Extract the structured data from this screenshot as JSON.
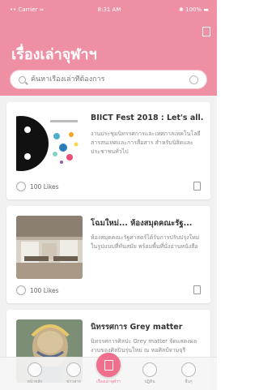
{
  "status_bar": {
    "left": "•• Carrier ≈",
    "time": "8:31 AM",
    "right": "✱ 100% ▬"
  },
  "header": {
    "title": "เรื่องเล่าจุฬาฯ",
    "icon": "document-icon"
  },
  "search": {
    "placeholder": "ค้นหาเรื่องเล่าที่ต้องการ"
  },
  "cards": [
    {
      "title": "BIICT Fest 2018 : Let's all...",
      "description": "งานประชุมนิทรรศการและเทศกาลเทคโนโลยีสารสนเทศและการสื่อสาร สำหรับนิสิตและประชาชนทั่วไป",
      "likes": "100 Likes",
      "icons": [
        "thumb-icon",
        "like-circle-icon",
        "bookmark-icon"
      ]
    },
    {
      "title": "โฉมใหม่... ห้องสมุดคณะรัฐ...",
      "description": "ห้องสมุดคณะรัฐศาสตร์ได้รับการปรับปรุงใหม่ในรูปแบบที่ทันสมัย พร้อมพื้นที่นั่งอ่านหนังสือ",
      "likes": "100 Likes",
      "icons": [
        "thumb-icon",
        "like-circle-icon",
        "bookmark-icon"
      ]
    },
    {
      "title": "นิทรรศการ Grey matter",
      "description": "นิทรรศการศิลปะ Grey matter จัดแสดงผลงานของศิลปินรุ่นใหม่ ณ หอศิลป์จามจุรี",
      "likes": "",
      "icons": [
        "thumb-icon"
      ]
    }
  ],
  "tabbar": {
    "items": [
      {
        "label": "หน้าหลัก",
        "icon": "home-icon"
      },
      {
        "label": "ข่าวสาร",
        "icon": "news-icon"
      },
      {
        "label": "เรื่องเล่าจุฬาฯ",
        "icon": "story-icon",
        "active": true
      },
      {
        "label": "ปฏิทิน",
        "icon": "calendar-icon"
      },
      {
        "label": "อื่นๆ",
        "icon": "more-icon"
      }
    ]
  },
  "colors": {
    "brand_pink": "#ef8fa4",
    "active_pink": "#ef6f8d"
  }
}
